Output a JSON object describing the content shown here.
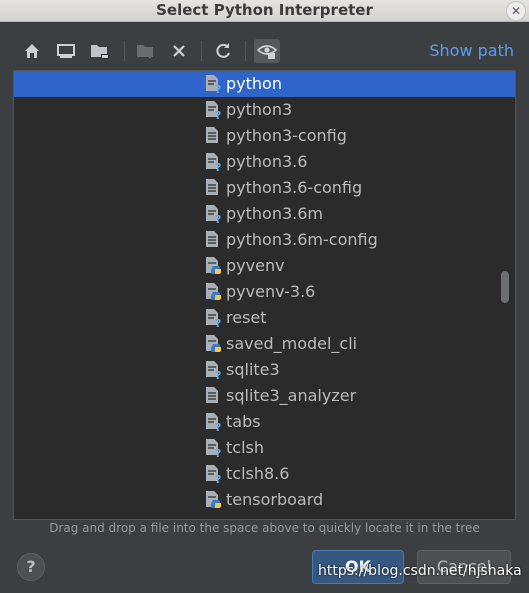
{
  "window": {
    "title": "Select Python Interpreter",
    "close_glyph": "✕"
  },
  "toolbar": {
    "buttons": [
      {
        "name": "home-button",
        "icon": "home-icon"
      },
      {
        "name": "desktop-button",
        "icon": "desktop-icon"
      },
      {
        "name": "project-folder-button",
        "icon": "folder-icon"
      },
      {
        "name": "new-folder-button",
        "icon": "new-folder-icon"
      },
      {
        "name": "delete-button",
        "icon": "delete-icon"
      },
      {
        "name": "refresh-button",
        "icon": "refresh-icon"
      },
      {
        "name": "show-hidden-button",
        "icon": "eye-icon"
      }
    ],
    "show_path": "Show path"
  },
  "tree": {
    "items": [
      {
        "label": "python",
        "icon": "python-file-icon",
        "selected": true
      },
      {
        "label": "python3",
        "icon": "python-file-icon",
        "selected": false
      },
      {
        "label": "python3-config",
        "icon": "text-file-icon",
        "selected": false
      },
      {
        "label": "python3.6",
        "icon": "python-file-icon",
        "selected": false
      },
      {
        "label": "python3.6-config",
        "icon": "text-file-icon",
        "selected": false
      },
      {
        "label": "python3.6m",
        "icon": "python-file-icon",
        "selected": false
      },
      {
        "label": "python3.6m-config",
        "icon": "text-file-icon",
        "selected": false
      },
      {
        "label": "pyvenv",
        "icon": "python-script-icon",
        "selected": false
      },
      {
        "label": "pyvenv-3.6",
        "icon": "python-script-icon",
        "selected": false
      },
      {
        "label": "reset",
        "icon": "unknown-file-icon",
        "selected": false
      },
      {
        "label": "saved_model_cli",
        "icon": "python-script-icon",
        "selected": false
      },
      {
        "label": "sqlite3",
        "icon": "unknown-file-icon",
        "selected": false
      },
      {
        "label": "sqlite3_analyzer",
        "icon": "text-file-icon",
        "selected": false
      },
      {
        "label": "tabs",
        "icon": "unknown-file-icon",
        "selected": false
      },
      {
        "label": "tclsh",
        "icon": "unknown-file-icon",
        "selected": false
      },
      {
        "label": "tclsh8.6",
        "icon": "unknown-file-icon",
        "selected": false
      },
      {
        "label": "tensorboard",
        "icon": "python-script-icon",
        "selected": false
      }
    ]
  },
  "hint": "Drag and drop a file into the space above to quickly locate it in the tree",
  "footer": {
    "help": "?",
    "ok": "OK",
    "cancel": "Cancel",
    "watermark": "https://blog.csdn.net/hjshaka"
  },
  "colors": {
    "background": "#3c3f41",
    "tree_background": "#2b2b2b",
    "selection": "#2f65ca",
    "link": "#589df6",
    "ok_button": "#365880"
  }
}
